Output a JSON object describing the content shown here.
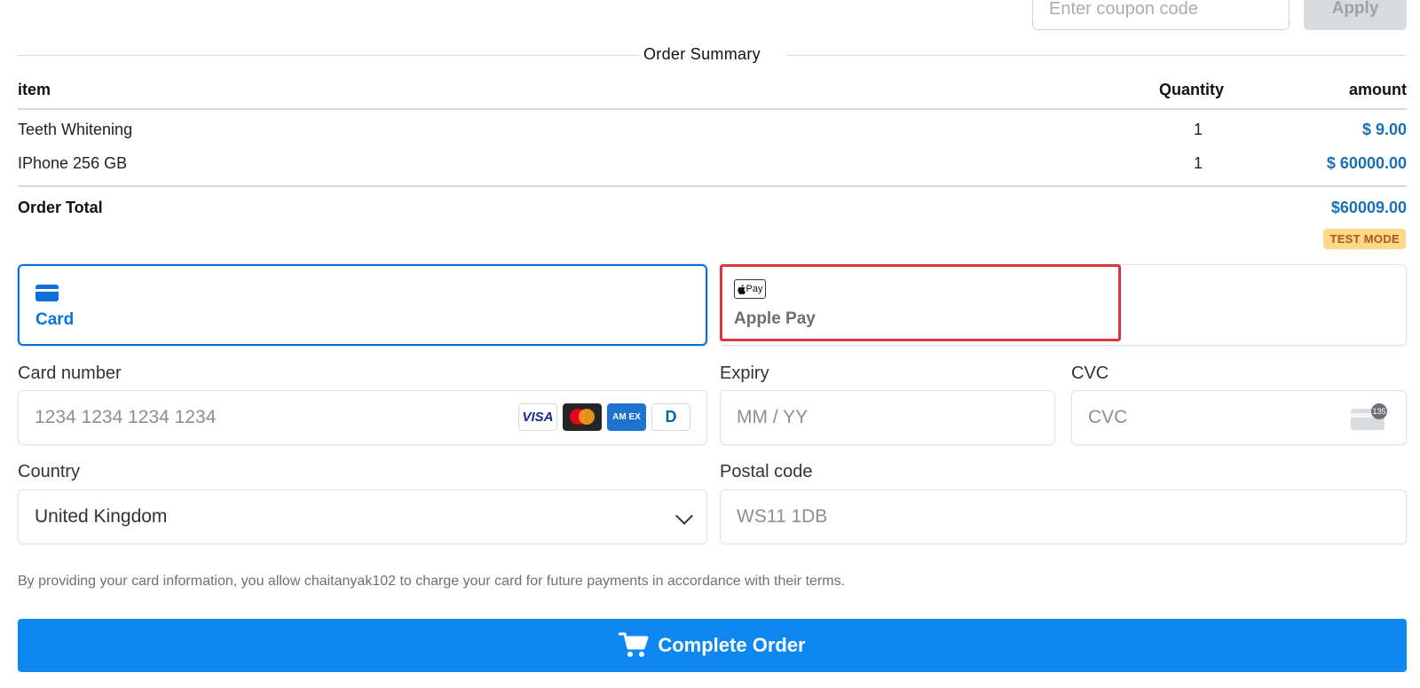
{
  "coupon": {
    "placeholder": "Enter coupon code",
    "apply_label": "Apply"
  },
  "summary": {
    "title": "Order Summary",
    "headers": {
      "item": "item",
      "quantity": "Quantity",
      "amount": "amount"
    },
    "rows": [
      {
        "item": "Teeth Whitening",
        "quantity": "1",
        "amount": "$ 9.00"
      },
      {
        "item": "IPhone 256 GB",
        "quantity": "1",
        "amount": "$ 60000.00"
      }
    ],
    "total_label": "Order Total",
    "total_value": "$60009.00",
    "mode_badge": "TEST MODE"
  },
  "payment_methods": {
    "card_label": "Card",
    "apple_pay_label": "Apple Pay",
    "apple_pay_icon_text": "Pay",
    "selected": "Card"
  },
  "fields": {
    "card_number": {
      "label": "Card number",
      "placeholder": "1234 1234 1234 1234"
    },
    "expiry": {
      "label": "Expiry",
      "placeholder": "MM / YY"
    },
    "cvc": {
      "label": "CVC",
      "placeholder": "CVC"
    },
    "country": {
      "label": "Country",
      "value": "United Kingdom"
    },
    "postal_code": {
      "label": "Postal code",
      "placeholder": "WS11 1DB"
    }
  },
  "card_brands": [
    "VISA",
    "mastercard",
    "AMEX",
    "diners"
  ],
  "card_brand_text": {
    "visa": "VISA",
    "amex": "AM EX",
    "diners": "D"
  },
  "disclaimer": "By providing your card information, you allow chaitanyak102 to charge your card for future payments in accordance with their terms.",
  "complete_button": {
    "label": "Complete Order"
  },
  "colors": {
    "primary": "#0f87f0",
    "selected_tab": "#0d6fd8",
    "amount": "#1a6fb5",
    "highlight": "#d9363e",
    "badge": "#fcd88a"
  }
}
